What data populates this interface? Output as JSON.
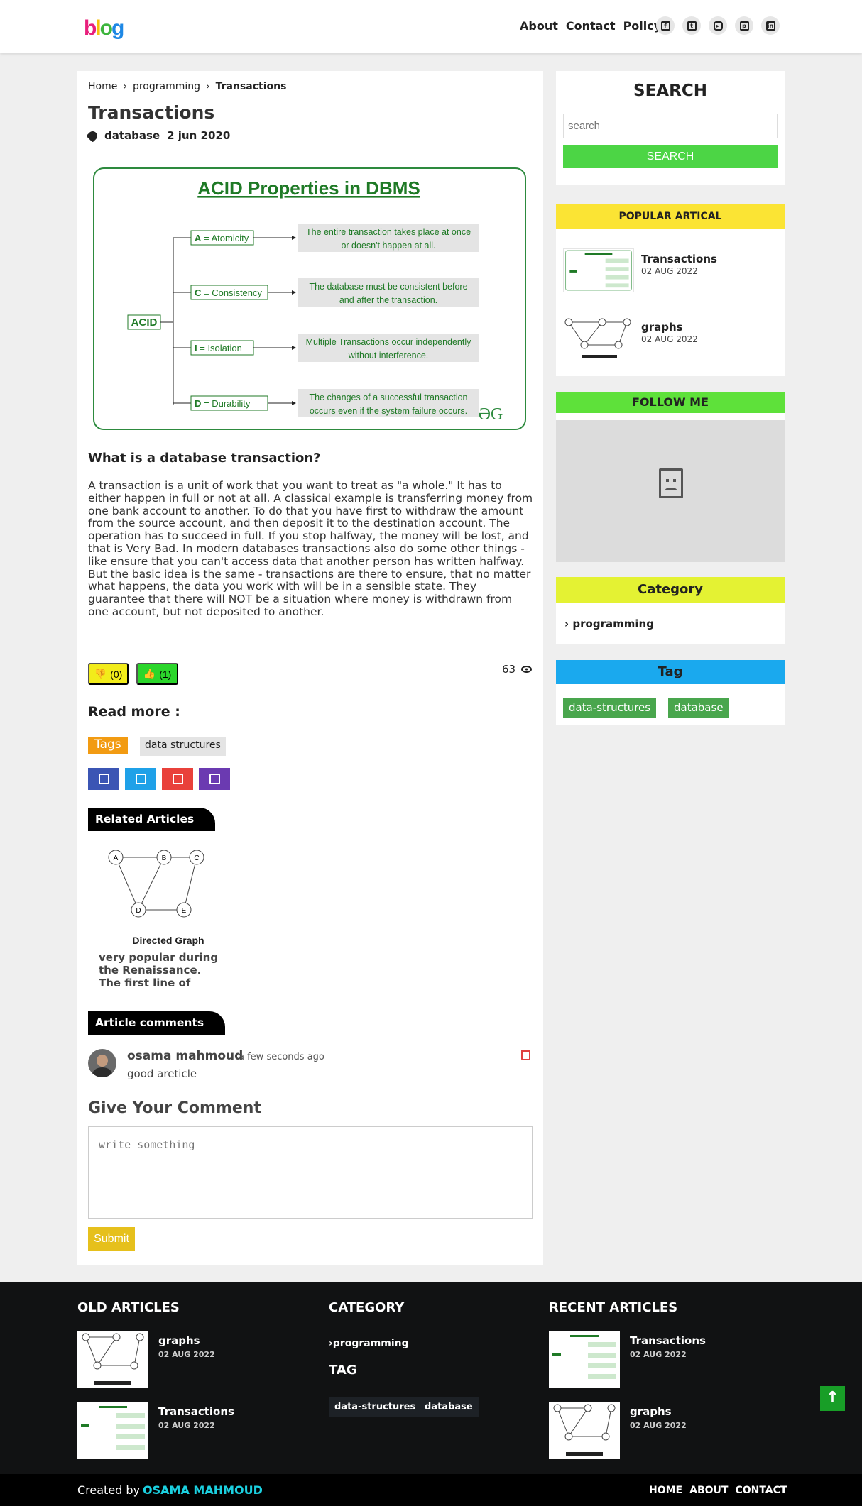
{
  "nav": {
    "logo": [
      "b",
      "l",
      "o",
      "g"
    ],
    "links": [
      "About",
      "Contact",
      "Policy"
    ],
    "social_icons": [
      "facebook-icon",
      "twitter-icon",
      "youtube-icon",
      "pinterest-icon",
      "linkedin-icon"
    ]
  },
  "breadcrumb": {
    "home": "Home",
    "category": "programming",
    "current": "Transactions"
  },
  "article": {
    "title": "Transactions",
    "tag": "database",
    "date": "2 jun 2020",
    "figure": {
      "title": "ACID Properties in DBMS",
      "root": "ACID",
      "logo": "ƏG",
      "rows": [
        {
          "letter": "A",
          "name": " = Atomicity",
          "desc1": "The entire transaction takes place at once",
          "desc2": "or doesn't happen at all."
        },
        {
          "letter": "C",
          "name": " = Consistency",
          "desc1": "The database must be consistent before",
          "desc2": "and after the transaction."
        },
        {
          "letter": "I",
          "name": " = Isolation",
          "desc1": "Multiple Transactions occur independently",
          "desc2": "without interference."
        },
        {
          "letter": "D",
          "name": " = Durability",
          "desc1": "The changes of a successful transaction",
          "desc2": "occurs even if the system failure occurs."
        }
      ]
    },
    "heading": "What is a database transaction?",
    "body": "A transaction is a unit of work that you want to treat as \"a whole.\" It has to either happen in full or not at all. A classical example is transferring money from one bank account to another. To do that you have first to withdraw the amount from the source account, and then deposit it to the destination account. The operation has to succeed in full. If you stop halfway, the money will be lost, and that is Very Bad. In modern databases transactions also do some other things - like ensure that you can't access data that another person has written halfway. But the basic idea is the same - transactions are there to ensure, that no matter what happens, the data you work with will be in a sensible state. They guarantee that there will NOT be a situation where money is withdrawn from one account, but not deposited to another.",
    "dislikes": "(0)",
    "likes": "(1)",
    "views": "63",
    "read_more": "Read more :",
    "tags_label": "Tags",
    "tags": [
      "data structures"
    ],
    "share_colors": [
      "#3b55b4",
      "#1fa1e8",
      "#e9413b",
      "#6b3ab1"
    ]
  },
  "related": {
    "label": "Related Articles",
    "graph_label": "Directed Graph",
    "nodes": [
      "A",
      "B",
      "C",
      "D",
      "E"
    ],
    "text": "very popular during the Renaissance. The first line of"
  },
  "comments": {
    "label": "Article comments",
    "items": [
      {
        "name": "osama mahmoud",
        "time": "a few seconds ago",
        "text": "good areticle"
      }
    ]
  },
  "form": {
    "title": "Give Your Comment",
    "placeholder": "write something",
    "submit": "Submit"
  },
  "sidebar": {
    "search_title": "SEARCH",
    "search_placeholder": "search",
    "search_button": "SEARCH",
    "popular_title": "POPULAR ARTICAL",
    "popular": [
      {
        "title": "Transactions",
        "date": "02 AUG 2022"
      },
      {
        "title": "graphs",
        "date": "02 AUG 2022"
      }
    ],
    "follow_title": "FOLLOW ME",
    "category_title": "Category",
    "categories": [
      "programming"
    ],
    "tag_title": "Tag",
    "tags": [
      "data-structures",
      "database"
    ],
    "colors": {
      "popular": "#fbe434",
      "follow": "#5ee13a",
      "category": "#e4f233",
      "tag": "#1aa9ee"
    }
  },
  "footer": {
    "old_title": "OLD ARTICLES",
    "old": [
      {
        "title": "graphs",
        "date": "02 AUG 2022"
      },
      {
        "title": "Transactions",
        "date": "02 AUG 2022"
      }
    ],
    "category_title": "CATEGORY",
    "categories": [
      "programming"
    ],
    "tag_title": "TAG",
    "tags": [
      "data-structures",
      "database"
    ],
    "recent_title": "RECENT ARTICLES",
    "recent": [
      {
        "title": "Transactions",
        "date": "02 AUG 2022"
      },
      {
        "title": "graphs",
        "date": "02 AUG 2022"
      }
    ],
    "created": "Created by",
    "author": "OSAMA MAHMOUD",
    "links": [
      "HOME",
      "ABOUT",
      "CONTACT"
    ]
  }
}
